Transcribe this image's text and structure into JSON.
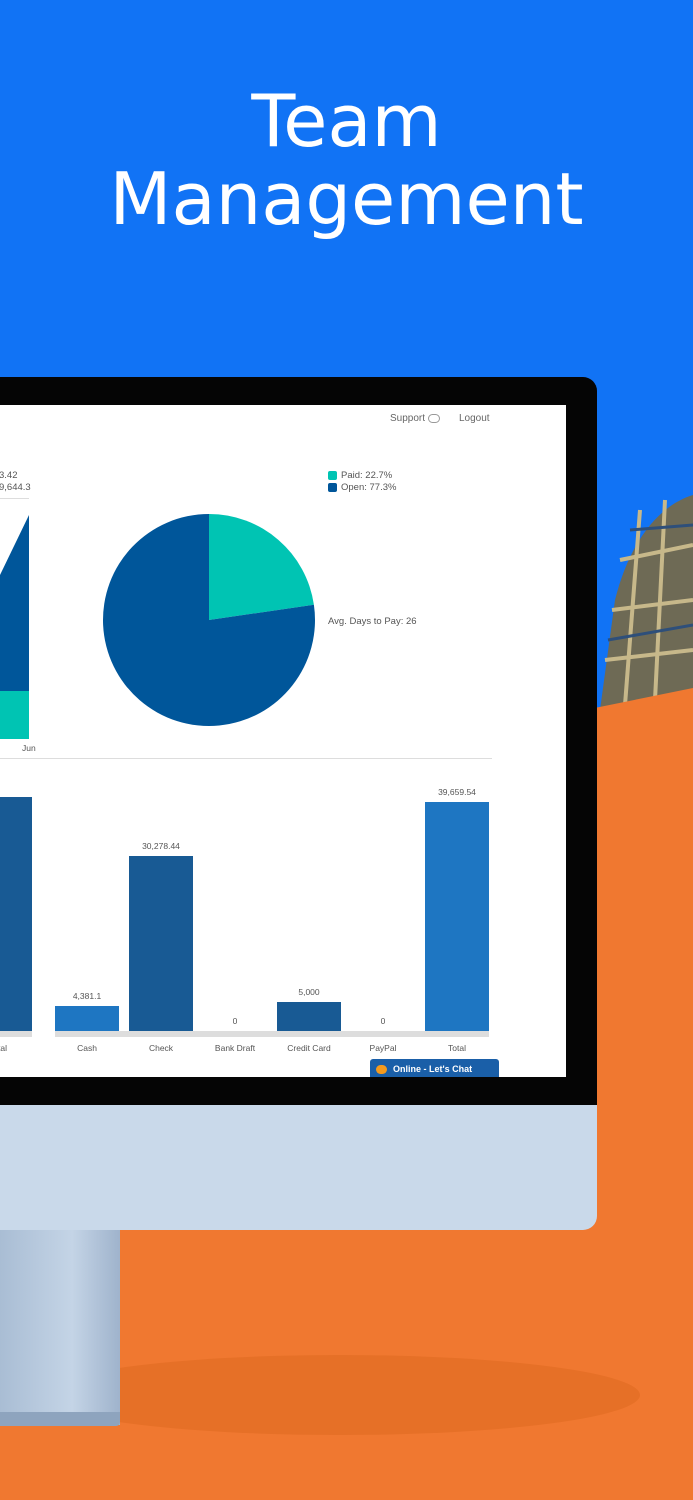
{
  "headline": {
    "line1": "Team",
    "line2": "Management"
  },
  "colors": {
    "background_blue": "#1173F5",
    "background_orange": "#F07830",
    "teal": "#00C4B3",
    "dark_blue": "#00569A",
    "bar_dark": "#185A94",
    "bar_light": "#1E76C2"
  },
  "app": {
    "support_label": "Support",
    "logout_label": "Logout",
    "left_chart_partial": {
      "value1": "3.42",
      "value2": "9,644.3",
      "xlabel": "Jun",
      "bar_label_partial": "tal"
    },
    "chat_button": "Online - Let's Chat"
  },
  "chart_data": [
    {
      "type": "pie",
      "legend": [
        "Paid: 22.7%",
        "Open: 77.3%"
      ],
      "slices": [
        {
          "name": "Paid",
          "value": 22.7,
          "color": "#00C4B3"
        },
        {
          "name": "Open",
          "value": 77.3,
          "color": "#00569A"
        }
      ],
      "annotation": "Avg. Days to Pay: 26",
      "legend_position": "top-right"
    },
    {
      "type": "bar",
      "categories": [
        "Cash",
        "Check",
        "Bank Draft",
        "Credit Card",
        "PayPal",
        "Total"
      ],
      "values": [
        4381.1,
        30278.44,
        0,
        5000,
        0,
        39659.54
      ],
      "value_labels": [
        "4,381.1",
        "30,278.44",
        "0",
        "5,000",
        "0",
        "39,659.54"
      ],
      "colors": [
        "#1E76C2",
        "#185A94",
        "#185A94",
        "#185A94",
        "#185A94",
        "#1E76C2"
      ],
      "ylim": [
        0,
        39659.54
      ]
    }
  ]
}
